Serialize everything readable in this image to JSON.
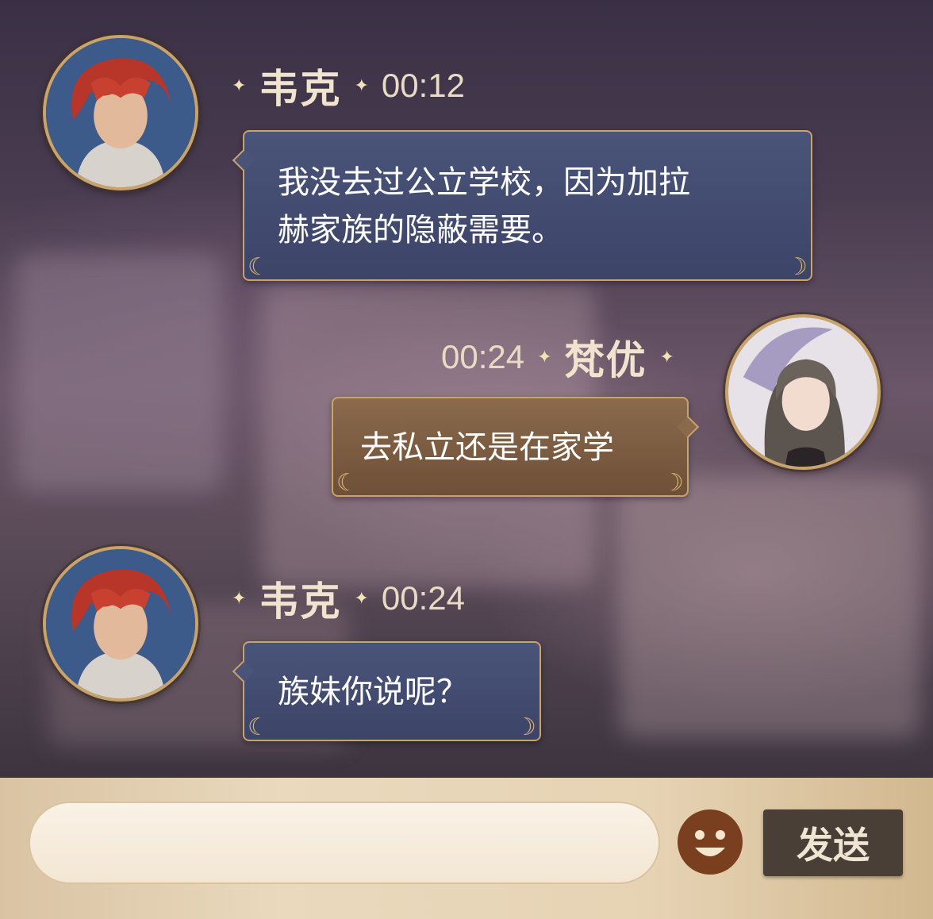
{
  "messages": [
    {
      "sender": "韦克",
      "time": "00:12",
      "text_lines": [
        "我没去过公立学校，因为加拉",
        "赫家族的隐蔽需要。"
      ],
      "side": "left"
    },
    {
      "sender": "梵优",
      "time": "00:24",
      "text_lines": [
        "去私立还是在家学"
      ],
      "side": "right"
    },
    {
      "sender": "韦克",
      "time": "00:24",
      "text_lines": [
        "族妹你说呢？"
      ],
      "side": "left"
    }
  ],
  "composer": {
    "placeholder": "",
    "value": "",
    "send_label": "发送",
    "emoji_icon": "smiley-face-icon"
  },
  "colors": {
    "bubble_blue": "#434c72",
    "bubble_gold": "#7d5e43",
    "gold_border": "#c9a46a",
    "send_bg": "#4a3f36"
  }
}
